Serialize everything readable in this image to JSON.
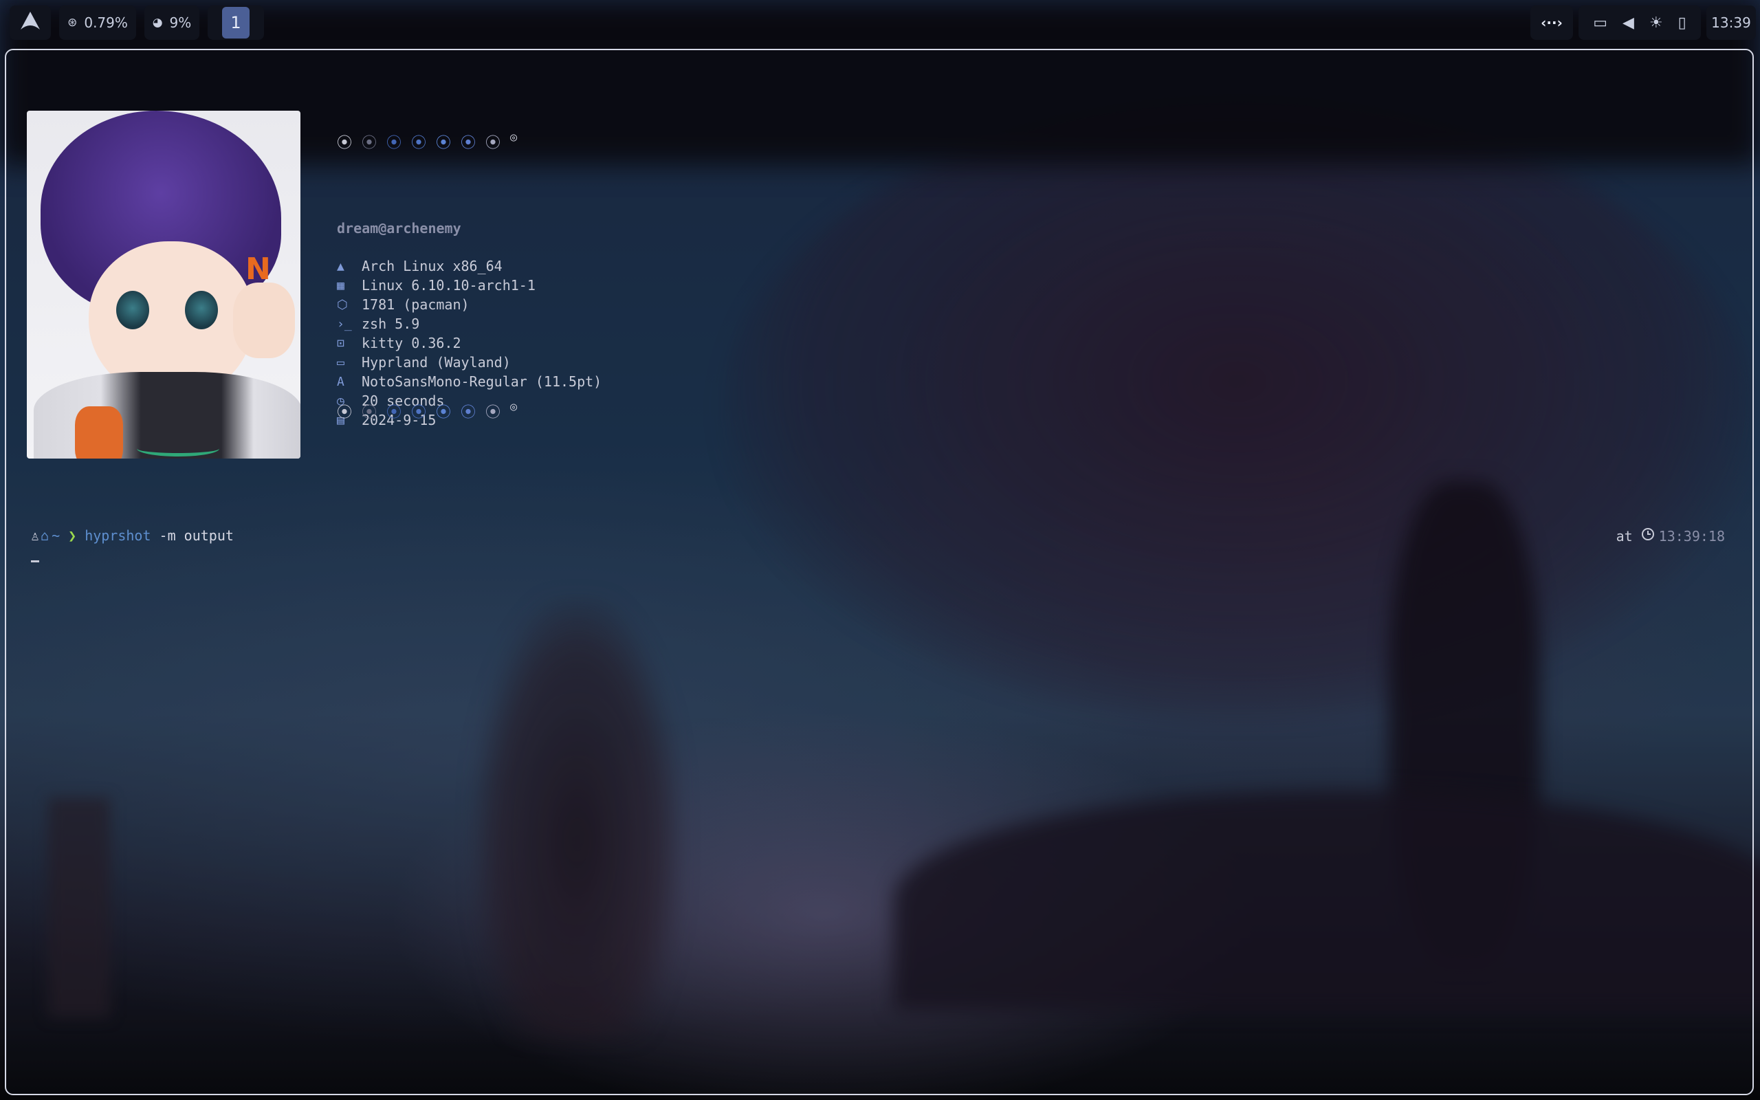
{
  "topbar": {
    "launcher_icon": "arch-logo-icon",
    "cpu": {
      "icon": "cpu-icon",
      "value": "0.79%"
    },
    "memory": {
      "icon": "memory-icon",
      "value": "9%"
    },
    "workspace": "1",
    "tray": {
      "vpn_icon": "code-brackets-icon",
      "display_icon": "monitor-icon",
      "volume_icon": "volume-icon",
      "brightness_icon": "brightness-icon",
      "battery_icon": "battery-icon"
    },
    "clock": "13:39"
  },
  "terminal": {
    "fetch": {
      "dot_colors": [
        "#c6c8d4",
        "#6c6f84",
        "#4266b5",
        "#4f74c4",
        "#5b83d4",
        "#5f7fd0",
        "#a5a8bf",
        "#c6c8d4"
      ],
      "userhost": "dream@archenemy",
      "rows": [
        {
          "icon": "arch-logo-icon",
          "text": "Arch Linux x86_64"
        },
        {
          "icon": "kernel-icon",
          "text": "Linux 6.10.10-arch1-1"
        },
        {
          "icon": "package-icon",
          "text": "1781 (pacman)"
        },
        {
          "icon": "shell-icon",
          "text": "zsh 5.9"
        },
        {
          "icon": "terminal-icon",
          "text": "kitty 0.36.2"
        },
        {
          "icon": "window-icon",
          "text": "Hyprland (Wayland)"
        },
        {
          "icon": "font-icon",
          "text": "NotoSansMono-Regular (11.5pt)"
        },
        {
          "icon": "clock-icon",
          "text": "20 seconds"
        },
        {
          "icon": "calendar-icon",
          "text": "2024-9-15"
        }
      ]
    },
    "prompt": {
      "os_icon": "linux-penguin-icon",
      "home_icon": "home-icon",
      "dir": "~",
      "arrow": "❯",
      "command": "hyprshot",
      "args": " -m output"
    },
    "right_prompt": {
      "at": "at",
      "clock_icon": "clock-icon",
      "time": "13:39:18"
    }
  }
}
